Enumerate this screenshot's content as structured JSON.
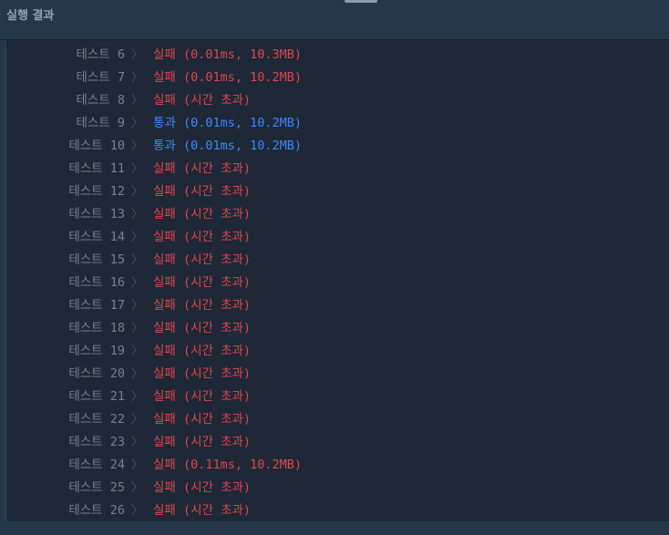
{
  "header": {
    "title": "실행 결과"
  },
  "colors": {
    "fail": "#e0454e",
    "pass": "#3d86ff",
    "label": "#78808a",
    "background": "#1e2836"
  },
  "results": [
    {
      "label": "테스트 6",
      "status": "fail",
      "text": "실패 (0.01ms, 10.3MB)"
    },
    {
      "label": "테스트 7",
      "status": "fail",
      "text": "실패 (0.01ms, 10.2MB)"
    },
    {
      "label": "테스트 8",
      "status": "fail",
      "text": "실패 (시간 초과)"
    },
    {
      "label": "테스트 9",
      "status": "pass",
      "text": "통과 (0.01ms, 10.2MB)"
    },
    {
      "label": "테스트 10",
      "status": "pass",
      "text": "통과 (0.01ms, 10.2MB)"
    },
    {
      "label": "테스트 11",
      "status": "fail",
      "text": "실패 (시간 초과)"
    },
    {
      "label": "테스트 12",
      "status": "fail",
      "text": "실패 (시간 초과)"
    },
    {
      "label": "테스트 13",
      "status": "fail",
      "text": "실패 (시간 초과)"
    },
    {
      "label": "테스트 14",
      "status": "fail",
      "text": "실패 (시간 초과)"
    },
    {
      "label": "테스트 15",
      "status": "fail",
      "text": "실패 (시간 초과)"
    },
    {
      "label": "테스트 16",
      "status": "fail",
      "text": "실패 (시간 초과)"
    },
    {
      "label": "테스트 17",
      "status": "fail",
      "text": "실패 (시간 초과)"
    },
    {
      "label": "테스트 18",
      "status": "fail",
      "text": "실패 (시간 초과)"
    },
    {
      "label": "테스트 19",
      "status": "fail",
      "text": "실패 (시간 초과)"
    },
    {
      "label": "테스트 20",
      "status": "fail",
      "text": "실패 (시간 초과)"
    },
    {
      "label": "테스트 21",
      "status": "fail",
      "text": "실패 (시간 초과)"
    },
    {
      "label": "테스트 22",
      "status": "fail",
      "text": "실패 (시간 초과)"
    },
    {
      "label": "테스트 23",
      "status": "fail",
      "text": "실패 (시간 초과)"
    },
    {
      "label": "테스트 24",
      "status": "fail",
      "text": "실패 (0.11ms, 10.2MB)"
    },
    {
      "label": "테스트 25",
      "status": "fail",
      "text": "실패 (시간 초과)"
    },
    {
      "label": "테스트 26",
      "status": "fail",
      "text": "실패 (시간 초과)"
    }
  ],
  "separator_glyph": "〉"
}
